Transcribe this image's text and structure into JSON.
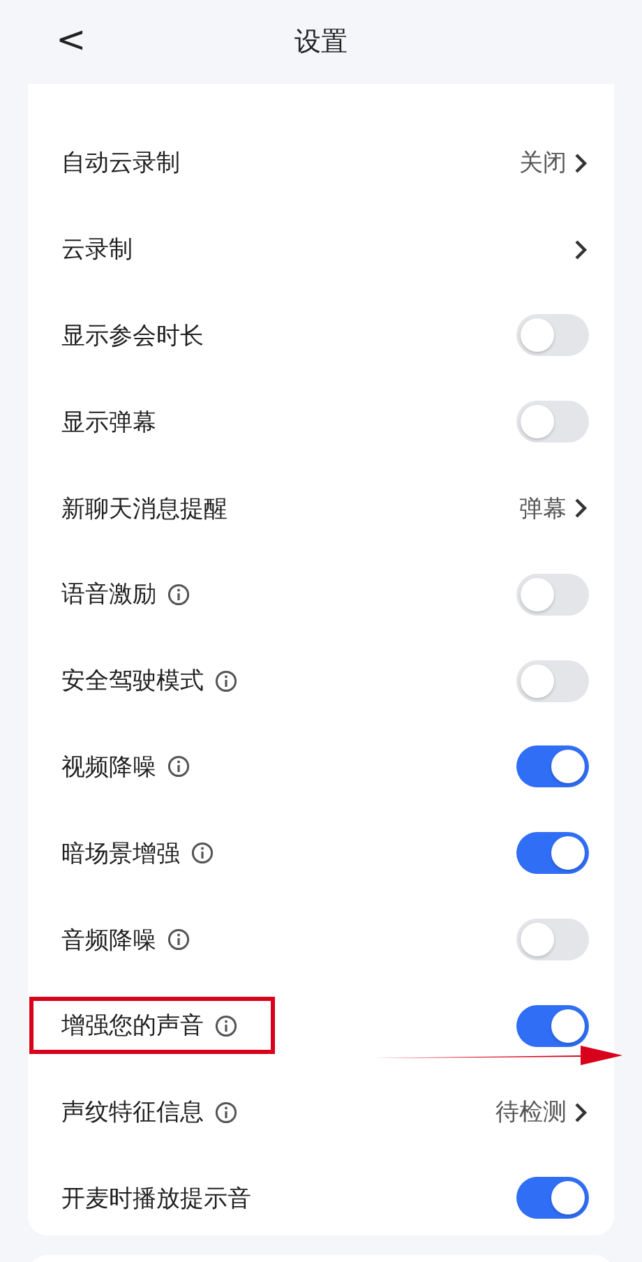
{
  "header": {
    "back": "<",
    "title": "设置"
  },
  "rows": [
    {
      "label": "自动云录制",
      "info": false,
      "kind": "value",
      "value": "关闭",
      "highlighted": false
    },
    {
      "label": "云录制",
      "info": false,
      "kind": "link",
      "highlighted": false
    },
    {
      "label": "显示参会时长",
      "info": false,
      "kind": "toggle",
      "on": false,
      "highlighted": false
    },
    {
      "label": "显示弹幕",
      "info": false,
      "kind": "toggle",
      "on": false,
      "highlighted": false
    },
    {
      "label": "新聊天消息提醒",
      "info": false,
      "kind": "value",
      "value": "弹幕",
      "highlighted": false
    },
    {
      "label": "语音激励",
      "info": true,
      "kind": "toggle",
      "on": false,
      "highlighted": false
    },
    {
      "label": "安全驾驶模式",
      "info": true,
      "kind": "toggle",
      "on": false,
      "highlighted": false
    },
    {
      "label": "视频降噪",
      "info": true,
      "kind": "toggle",
      "on": true,
      "highlighted": false
    },
    {
      "label": "暗场景增强",
      "info": true,
      "kind": "toggle",
      "on": true,
      "highlighted": false
    },
    {
      "label": "音频降噪",
      "info": true,
      "kind": "toggle",
      "on": false,
      "highlighted": false
    },
    {
      "label": "增强您的声音",
      "info": true,
      "kind": "toggle",
      "on": true,
      "highlighted": true
    },
    {
      "label": "声纹特征信息",
      "info": true,
      "kind": "value",
      "value": "待检测",
      "highlighted": false
    },
    {
      "label": "开麦时播放提示音",
      "info": false,
      "kind": "toggle",
      "on": true,
      "highlighted": false
    }
  ]
}
